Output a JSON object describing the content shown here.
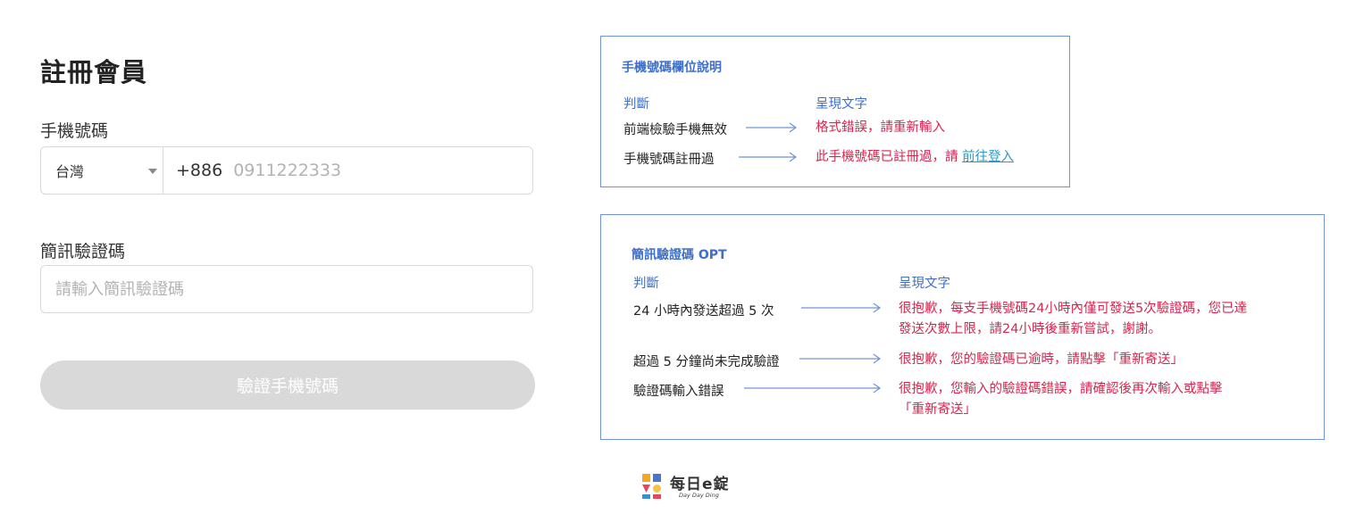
{
  "form": {
    "title": "註冊會員",
    "phone_label": "手機號碼",
    "country_value": "台灣",
    "dial_code": "+886",
    "phone_placeholder": "0911222333",
    "sms_label": "簡訊驗證碼",
    "sms_placeholder": "請輸入簡訊驗證碼",
    "verify_button": "驗證手機號碼"
  },
  "phone_notes": {
    "title": "手機號碼欄位說明",
    "col_condition": "判斷",
    "col_text": "呈現文字",
    "rows": [
      {
        "condition": "前端檢驗手機無效",
        "text": "格式錯誤，請重新輸入"
      },
      {
        "condition": "手機號碼註冊過",
        "text": "此手機號碼已註冊過，請 ",
        "link": "前往登入"
      }
    ]
  },
  "sms_notes": {
    "title": "簡訊驗證碼 OPT",
    "col_condition": "判斷",
    "col_text": "呈現文字",
    "rows": [
      {
        "condition": "24 小時內發送超過 5 次",
        "text_line1": "很抱歉，每支手機號碼24小時內僅可發送5次驗證碼，您已達",
        "text_line2": "發送次數上限，請24小時後重新嘗試，謝謝。"
      },
      {
        "condition": "超過 5 分鐘尚未完成驗證",
        "text_line1": "很抱歉，您的驗證碼已逾時，請點擊「重新寄送」"
      },
      {
        "condition": "驗證碼輸入錯誤",
        "text_line1": "很抱歉，您輸入的驗證碼錯誤，請確認後再次輸入或點擊",
        "text_line2": "「重新寄送」"
      }
    ]
  },
  "logo": {
    "name": "每日e錠",
    "tagline": "Day Day Ding"
  },
  "colors": {
    "accent_blue": "#3f6fc9",
    "box_border": "#6f93d8",
    "error_red": "#d6264f",
    "link": "#2a9bc1",
    "button_disabled": "#d9d9d9"
  }
}
